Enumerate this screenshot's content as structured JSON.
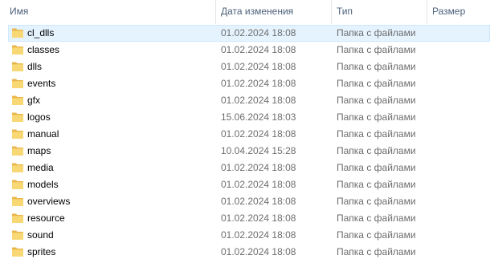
{
  "columns": {
    "name": "Имя",
    "date": "Дата изменения",
    "type": "Тип",
    "size": "Размер"
  },
  "icons": {
    "folder": "folder-icon",
    "sort": "sort-ascending-icon"
  },
  "colors": {
    "header_text": "#4c607a",
    "meta_text": "#6d6d6d",
    "folder_fill": "#f8d775",
    "folder_tab": "#e8b548",
    "hover_bg": "#e5f3ff",
    "hover_border": "#cde8ff"
  },
  "rows": [
    {
      "name": "cl_dlls",
      "date": "01.02.2024 18:08",
      "type": "Папка с файлами",
      "size": ""
    },
    {
      "name": "classes",
      "date": "01.02.2024 18:08",
      "type": "Папка с файлами",
      "size": ""
    },
    {
      "name": "dlls",
      "date": "01.02.2024 18:08",
      "type": "Папка с файлами",
      "size": ""
    },
    {
      "name": "events",
      "date": "01.02.2024 18:08",
      "type": "Папка с файлами",
      "size": ""
    },
    {
      "name": "gfx",
      "date": "01.02.2024 18:08",
      "type": "Папка с файлами",
      "size": ""
    },
    {
      "name": "logos",
      "date": "15.06.2024 18:03",
      "type": "Папка с файлами",
      "size": ""
    },
    {
      "name": "manual",
      "date": "01.02.2024 18:08",
      "type": "Папка с файлами",
      "size": ""
    },
    {
      "name": "maps",
      "date": "10.04.2024 15:28",
      "type": "Папка с файлами",
      "size": ""
    },
    {
      "name": "media",
      "date": "01.02.2024 18:08",
      "type": "Папка с файлами",
      "size": ""
    },
    {
      "name": "models",
      "date": "01.02.2024 18:08",
      "type": "Папка с файлами",
      "size": ""
    },
    {
      "name": "overviews",
      "date": "01.02.2024 18:08",
      "type": "Папка с файлами",
      "size": ""
    },
    {
      "name": "resource",
      "date": "01.02.2024 18:08",
      "type": "Папка с файлами",
      "size": ""
    },
    {
      "name": "sound",
      "date": "01.02.2024 18:08",
      "type": "Папка с файлами",
      "size": ""
    },
    {
      "name": "sprites",
      "date": "01.02.2024 18:08",
      "type": "Папка с файлами",
      "size": ""
    }
  ]
}
